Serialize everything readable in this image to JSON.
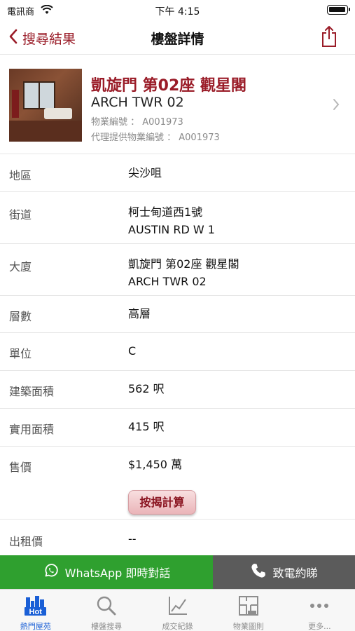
{
  "status_bar": {
    "carrier": "電訊商",
    "time": "下午 4:15"
  },
  "nav": {
    "back_label": "搜尋結果",
    "title": "樓盤詳情",
    "back_icon": "chevron-left-icon",
    "share_icon": "share-icon"
  },
  "summary": {
    "title_zh": "凱旋門 第02座 觀星閣",
    "title_en": "ARCH TWR 02",
    "property_no": "物業編號 ： A001973",
    "agent_property_no": "代理提供物業編號 ： A001973"
  },
  "details": [
    {
      "label": "地區",
      "value": "尖沙咀",
      "value2": ""
    },
    {
      "label": "街道",
      "value": "柯士甸道西1號",
      "value2": "AUSTIN RD W 1"
    },
    {
      "label": "大廈",
      "value": "凱旋門 第02座 觀星閣",
      "value2": "ARCH TWR 02"
    },
    {
      "label": "層數",
      "value": "高層",
      "value2": ""
    },
    {
      "label": "單位",
      "value": "C",
      "value2": ""
    },
    {
      "label": "建築面積",
      "value": "562 呎",
      "value2": ""
    },
    {
      "label": "實用面積",
      "value": "415 呎",
      "value2": ""
    },
    {
      "label": "售價",
      "value": "$1,450 萬",
      "value2": ""
    },
    {
      "label": "出租價",
      "value": "--",
      "value2": ""
    }
  ],
  "mortgage_button": "按揭計算",
  "actions": {
    "whatsapp": "WhatsApp 即時對話",
    "call": "致電約睇"
  },
  "tabs": [
    {
      "label": "熱門屋苑",
      "icon": "hot-buildings-icon",
      "active": true
    },
    {
      "label": "樓盤搜尋",
      "icon": "search-icon",
      "active": false
    },
    {
      "label": "成交紀錄",
      "icon": "chart-icon",
      "active": false
    },
    {
      "label": "物業圖則",
      "icon": "floor-plan-icon",
      "active": false
    },
    {
      "label": "更多...",
      "icon": "more-icon",
      "active": false
    }
  ],
  "hot_badge": "Hot",
  "colors": {
    "accent": "#9a1c28",
    "whatsapp": "#2fa02f",
    "call": "#5b5b5b",
    "tab_active": "#1a5fd6"
  }
}
